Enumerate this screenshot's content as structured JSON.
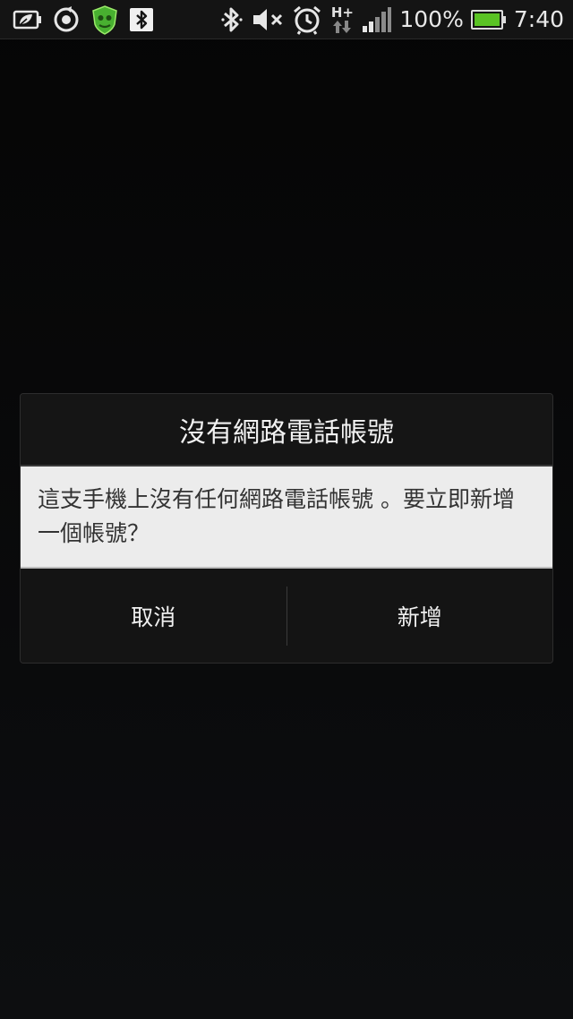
{
  "status_bar": {
    "icons_left": [
      "battery-saver-icon",
      "sync-icon",
      "security-shield-icon",
      "bluetooth-notification-icon"
    ],
    "icons_right": [
      "bluetooth-icon",
      "mute-icon",
      "alarm-icon",
      "hplus-data-icon",
      "signal-icon"
    ],
    "network_label": "H+",
    "battery_percent": "100%",
    "time": "7:40",
    "battery_color": "#5ac324",
    "shield_color": "#48b030"
  },
  "dialog": {
    "title": "沒有網路電話帳號",
    "message": "這支手機上沒有任何網路電話帳號 。要立即新增一個帳號？",
    "buttons": {
      "cancel": "取消",
      "add": "新增"
    }
  }
}
